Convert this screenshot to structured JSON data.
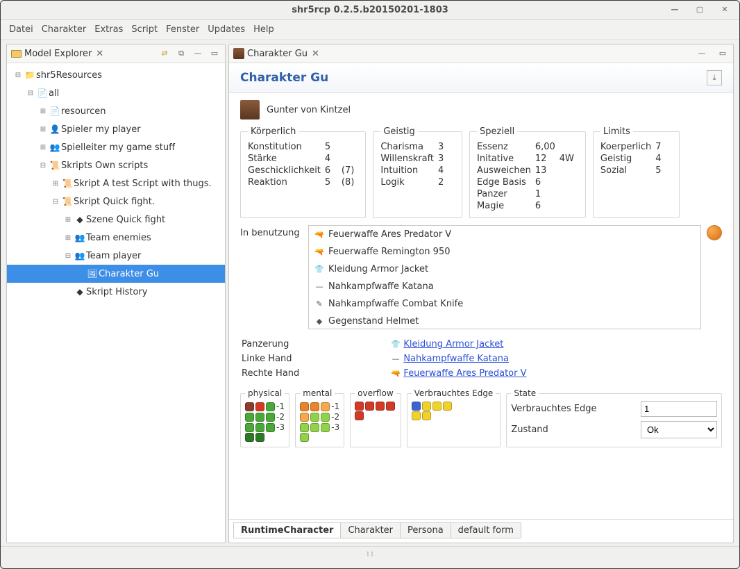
{
  "window": {
    "title": "shr5rcp 0.2.5.b20150201-1803"
  },
  "menubar": [
    "Datei",
    "Charakter",
    "Extras",
    "Script",
    "Fenster",
    "Updates",
    "Help"
  ],
  "explorer": {
    "title": "Model Explorer",
    "tree": [
      {
        "depth": 0,
        "exp": "-",
        "icon": "folder",
        "label": "shr5Resources"
      },
      {
        "depth": 1,
        "exp": "-",
        "icon": "doc",
        "label": "all"
      },
      {
        "depth": 2,
        "exp": "+",
        "icon": "doc",
        "label": "resourcen"
      },
      {
        "depth": 2,
        "exp": "+",
        "icon": "person",
        "label": "Spieler my player"
      },
      {
        "depth": 2,
        "exp": "+",
        "icon": "group",
        "label": "Spielleiter my game stuff"
      },
      {
        "depth": 2,
        "exp": "-",
        "icon": "script",
        "label": "Skripts Own scripts"
      },
      {
        "depth": 3,
        "exp": "+",
        "icon": "script",
        "label": "Skript A test Script with thugs."
      },
      {
        "depth": 3,
        "exp": "-",
        "icon": "script",
        "label": "Skript Quick fight."
      },
      {
        "depth": 4,
        "exp": "+",
        "icon": "diamond",
        "label": "Szene Quick fight"
      },
      {
        "depth": 4,
        "exp": "+",
        "icon": "team",
        "label": "Team enemies"
      },
      {
        "depth": 4,
        "exp": "-",
        "icon": "team",
        "label": "Team player"
      },
      {
        "depth": 5,
        "exp": "",
        "icon": "portrait",
        "label": "Charakter Gu",
        "selected": true
      },
      {
        "depth": 4,
        "exp": "",
        "icon": "diamond",
        "label": "Skript History"
      }
    ]
  },
  "editor": {
    "tab_title": "Charakter Gu",
    "heading": "Charakter Gu",
    "character_name": "Gunter von Kintzel",
    "koerperlich": {
      "title": "Körperlich",
      "rows": [
        [
          "Konstitution",
          "5",
          ""
        ],
        [
          "Stärke",
          "4",
          ""
        ],
        [
          "Geschicklichkeit",
          "6",
          "(7)"
        ],
        [
          "Reaktion",
          "5",
          "(8)"
        ]
      ]
    },
    "geistig": {
      "title": "Geistig",
      "rows": [
        [
          "Charisma",
          "3"
        ],
        [
          "Willenskraft",
          "3"
        ],
        [
          "Intuition",
          "4"
        ],
        [
          "Logik",
          "2"
        ]
      ]
    },
    "speziell": {
      "title": "Speziell",
      "rows": [
        [
          "Essenz",
          "6,00",
          ""
        ],
        [
          "Initative",
          "12",
          "4W"
        ],
        [
          "Ausweichen",
          "13",
          ""
        ],
        [
          "Edge Basis",
          "6",
          ""
        ],
        [
          "Panzer",
          "1",
          ""
        ],
        [
          "Magie",
          "6",
          ""
        ]
      ]
    },
    "limits": {
      "title": "Limits",
      "rows": [
        [
          "Koerperlich",
          "7"
        ],
        [
          "Geistig",
          "4"
        ],
        [
          "Sozial",
          "5"
        ]
      ]
    },
    "inuse_label": "In benutzung",
    "inuse_items": [
      {
        "icon": "gun",
        "label": "Feuerwaffe Ares Predator V"
      },
      {
        "icon": "gun",
        "label": "Feuerwaffe Remington 950"
      },
      {
        "icon": "shirt",
        "label": "Kleidung Armor Jacket"
      },
      {
        "icon": "sword",
        "label": "Nahkampfwaffe Katana"
      },
      {
        "icon": "knife",
        "label": "Nahkampfwaffe Combat Knife"
      },
      {
        "icon": "item",
        "label": "Gegenstand Helmet"
      }
    ],
    "equip": {
      "panzerung_label": "Panzerung",
      "panzerung_link": "Kleidung Armor Jacket",
      "linke_label": "Linke Hand",
      "linke_link": "Nahkampfwaffe Katana",
      "rechte_label": "Rechte Hand",
      "rechte_link": "Feuerwaffe Ares Predator V"
    },
    "monitors": {
      "physical": "physical",
      "mental": "mental",
      "overflow": "overflow",
      "edge": "Verbrauchtes Edge",
      "state": "State",
      "physical_labels": [
        "-1",
        "-2",
        "-3"
      ],
      "mental_labels": [
        "-1",
        "-2",
        "-3"
      ]
    },
    "state_form": {
      "edge_label": "Verbrauchtes Edge",
      "edge_value": "1",
      "zustand_label": "Zustand",
      "zustand_value": "Ok"
    },
    "tabs": [
      "RuntimeCharacter",
      "Charakter",
      "Persona",
      "default form"
    ],
    "active_tab": "RuntimeCharacter"
  }
}
